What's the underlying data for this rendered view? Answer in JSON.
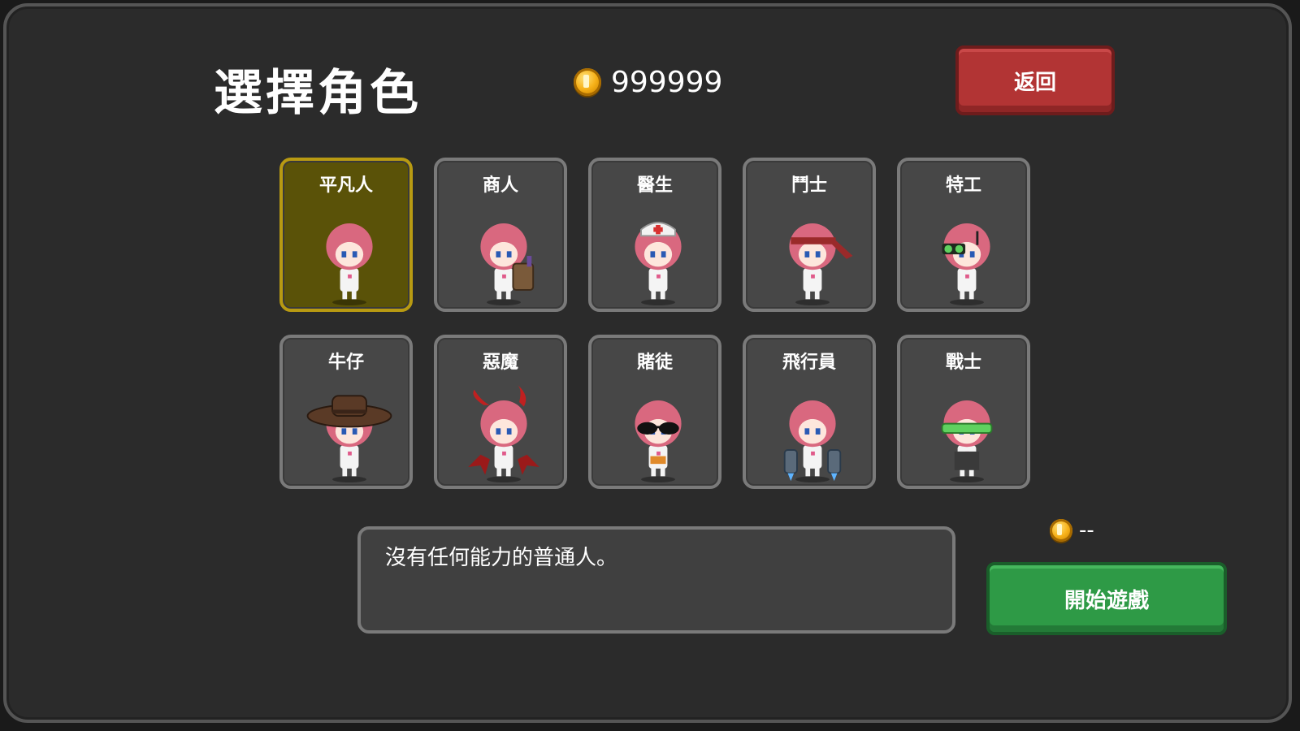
{
  "header": {
    "title": "選擇角色",
    "coin_count": "999999",
    "back_label": "返回"
  },
  "characters": [
    {
      "label": "平凡人",
      "selected": true,
      "accessory": "none"
    },
    {
      "label": "商人",
      "selected": false,
      "accessory": "backpack"
    },
    {
      "label": "醫生",
      "selected": false,
      "accessory": "nurse-cap"
    },
    {
      "label": "鬥士",
      "selected": false,
      "accessory": "headband"
    },
    {
      "label": "特工",
      "selected": false,
      "accessory": "night-vision-goggles"
    },
    {
      "label": "牛仔",
      "selected": false,
      "accessory": "cowboy-hat"
    },
    {
      "label": "惡魔",
      "selected": false,
      "accessory": "horns-and-wings"
    },
    {
      "label": "賭徒",
      "selected": false,
      "accessory": "sunglasses"
    },
    {
      "label": "飛行員",
      "selected": false,
      "accessory": "jetpack"
    },
    {
      "label": "戰士",
      "selected": false,
      "accessory": "green-visor"
    }
  ],
  "description": {
    "text": "沒有任何能力的普通人。"
  },
  "footer": {
    "cost_label": "--",
    "start_label": "開始遊戲"
  },
  "colors": {
    "selected_card": "#5a5208",
    "back_button": "#b23434",
    "start_button": "#2e9a46",
    "hair": "#d9687f"
  }
}
